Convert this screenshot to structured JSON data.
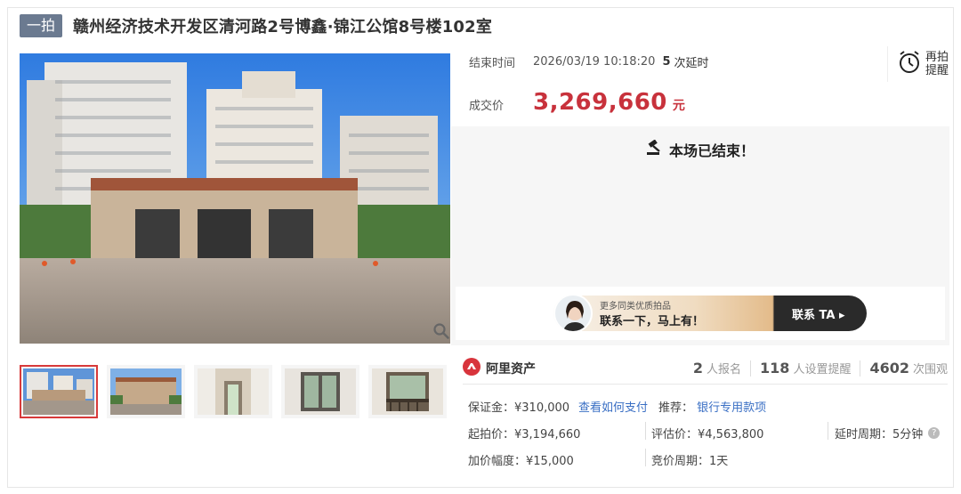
{
  "header": {
    "round_badge": "一拍",
    "title": "赣州经济技术开发区清河路2号博鑫·锦江公馆8号楼102室"
  },
  "auction": {
    "end_label": "结束时间",
    "end_time": "2026/03/19 10:18:20",
    "extension_count": "5",
    "extension_label": "次延时",
    "price_label": "成交价",
    "price": "3,269,660",
    "price_unit": "元",
    "status_text": "本场已结束！"
  },
  "remind": {
    "label": "再拍提醒",
    "icon": "alarm-clock-icon"
  },
  "banner": {
    "line1": "更多同类优质拍品",
    "line2": "联系一下，马上有！",
    "cta": "联系 TA ▸"
  },
  "stats": {
    "brand": "阿里资产",
    "signups_num": "2",
    "signups_label": "人报名",
    "reminders_num": "118",
    "reminders_label": "人设置提醒",
    "watchers_num": "4602",
    "watchers_label": "次围观"
  },
  "details": {
    "deposit": "保证金：¥310,000",
    "pay_link": "查看如何支付",
    "recommend_label": "推荐：",
    "recommend_link": "银行专用款项",
    "start_price": "起拍价：¥3,194,660",
    "appraisal": "评估价：¥4,563,800",
    "delay_period": "延时周期：5分钟",
    "increment": "加价幅度：¥15,000",
    "bid_period": "竞价周期：1天"
  },
  "colors": {
    "price_red": "#c8323c",
    "link_blue": "#3a6fc4",
    "badge_gray": "#6b7a90",
    "active_thumb_border": "#d83a3a"
  }
}
